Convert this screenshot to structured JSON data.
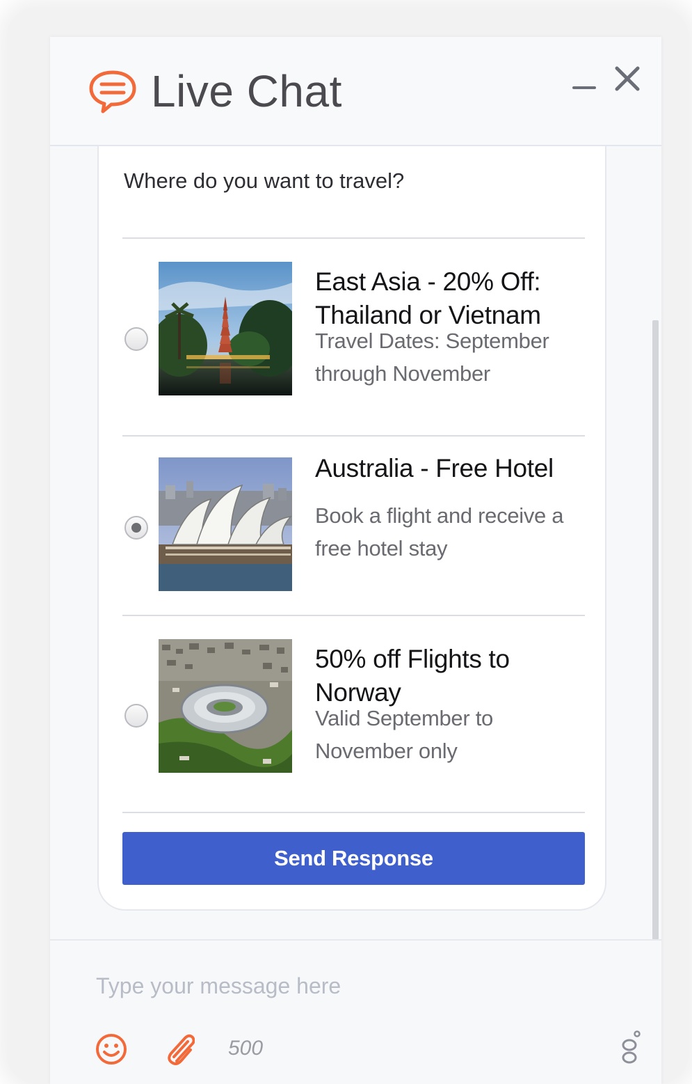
{
  "header": {
    "title": "Live Chat",
    "logo_icon": "chat-bubble-icon",
    "minimize_icon": "minimize-icon",
    "close_icon": "close-icon"
  },
  "question": "Where do you want to travel?",
  "options": [
    {
      "title": "East Asia - 20% Off: Thailand or Vietnam",
      "description": "Travel Dates: September through November",
      "selected": false,
      "image": "pagoda-lake-photo"
    },
    {
      "title": "Australia - Free Hotel",
      "description": "Book a flight and receive a free hotel stay",
      "selected": true,
      "image": "sydney-opera-house-photo"
    },
    {
      "title": "50% off Flights to Norway",
      "description": "Valid September to November only",
      "selected": false,
      "image": "stadium-aerial-photo"
    }
  ],
  "send_label": "Send Response",
  "composer": {
    "placeholder": "Type your message here",
    "char_limit": "500",
    "emoji_icon": "smiley-icon",
    "attach_icon": "paperclip-icon"
  },
  "colors": {
    "accent": "#f26a3a",
    "button": "#3f5fcd"
  }
}
